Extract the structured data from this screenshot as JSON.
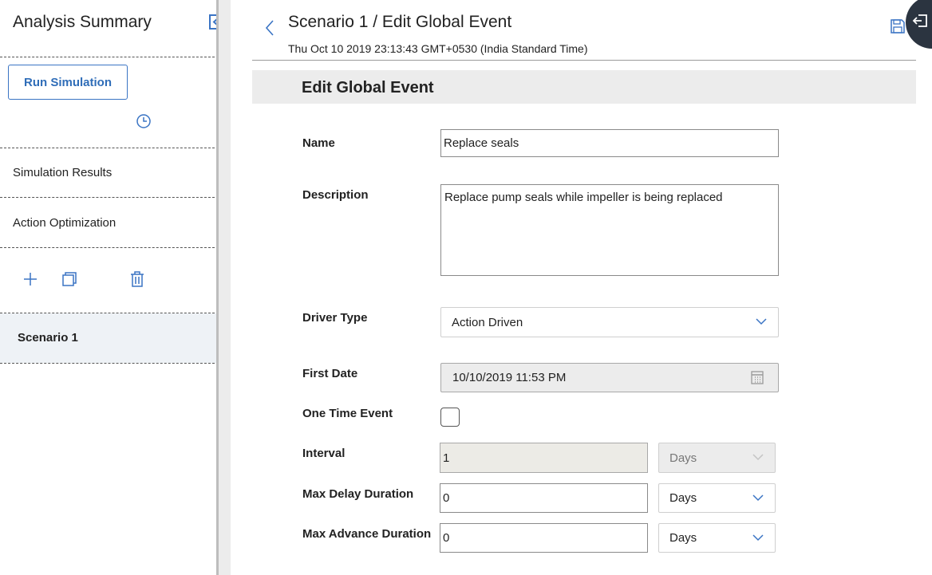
{
  "left_panel": {
    "title": "Analysis Summary",
    "run_button": "Run Simulation",
    "nav_items": [
      "Simulation Results",
      "Action Optimization"
    ],
    "scenario": "Scenario 1"
  },
  "header": {
    "title": "Scenario 1 / Edit Global Event",
    "timestamp": "Thu Oct 10 2019 23:13:43 GMT+0530 (India Standard Time)"
  },
  "form": {
    "section_title": "Edit Global Event",
    "name": {
      "label": "Name",
      "value": "Replace seals"
    },
    "description": {
      "label": "Description",
      "value": "Replace pump seals while impeller is being replaced"
    },
    "driver_type": {
      "label": "Driver Type",
      "value": "Action Driven"
    },
    "first_date": {
      "label": "First Date",
      "value": "10/10/2019 11:53 PM"
    },
    "one_time_event": {
      "label": "One Time Event",
      "checked": false
    },
    "interval": {
      "label": "Interval",
      "value": "1",
      "unit": "Days"
    },
    "max_delay": {
      "label": "Max Delay Duration",
      "value": "0",
      "unit": "Days"
    },
    "max_advance": {
      "label": "Max Advance Duration",
      "value": "0",
      "unit": "Days"
    }
  },
  "colors": {
    "accent": "#3a74c4",
    "panel_selected": "#eef2f6",
    "section_bg": "#ececec"
  },
  "icons": [
    "collapse-panel-icon",
    "clock-icon",
    "plus-icon",
    "copy-icon",
    "trash-icon",
    "back-chevron-icon",
    "save-icon",
    "exit-icon",
    "chevron-down-icon",
    "calendar-icon"
  ]
}
